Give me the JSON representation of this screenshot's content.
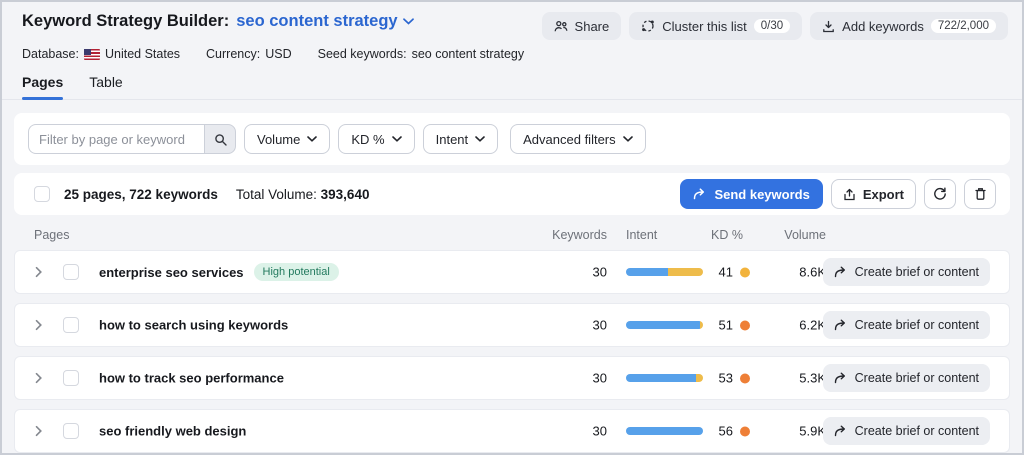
{
  "header": {
    "title": "Keyword Strategy Builder:",
    "list_name": "seo content strategy",
    "share_label": "Share",
    "cluster_label": "Cluster this list",
    "cluster_badge": "0/30",
    "add_keywords_label": "Add keywords",
    "add_keywords_badge": "722/2,000"
  },
  "meta": {
    "database_label": "Database:",
    "database_value": "United States",
    "currency_label": "Currency:",
    "currency_value": "USD",
    "seed_label": "Seed keywords:",
    "seed_value": "seo content strategy"
  },
  "tabs": {
    "pages": "Pages",
    "table": "Table"
  },
  "filters": {
    "search_placeholder": "Filter by page or keyword",
    "volume": "Volume",
    "kd": "KD %",
    "intent": "Intent",
    "advanced": "Advanced filters"
  },
  "summary": {
    "selection": "25 pages, 722 keywords",
    "total_volume_label": "Total Volume:",
    "total_volume_value": "393,640",
    "send_label": "Send keywords",
    "export_label": "Export"
  },
  "table": {
    "columns": {
      "pages": "Pages",
      "keywords": "Keywords",
      "intent": "Intent",
      "kd": "KD %",
      "volume": "Volume"
    },
    "action_label": "Create brief or content",
    "rows": [
      {
        "page": "enterprise seo services",
        "badge": "High potential",
        "keywords": "30",
        "intent_segments": [
          {
            "color": "#57a1ea",
            "pct": 55
          },
          {
            "color": "#eebc4b",
            "pct": 45
          }
        ],
        "kd": "41",
        "kd_color": "#f2b33c",
        "volume": "8.6K"
      },
      {
        "page": "how to search using keywords",
        "keywords": "30",
        "intent_segments": [
          {
            "color": "#57a1ea",
            "pct": 96
          },
          {
            "color": "#eebc4b",
            "pct": 4
          }
        ],
        "kd": "51",
        "kd_color": "#ee7f37",
        "volume": "6.2K"
      },
      {
        "page": "how to track seo performance",
        "keywords": "30",
        "intent_segments": [
          {
            "color": "#57a1ea",
            "pct": 91
          },
          {
            "color": "#eebc4b",
            "pct": 9
          }
        ],
        "kd": "53",
        "kd_color": "#ee7f37",
        "volume": "5.3K"
      },
      {
        "page": "seo friendly web design",
        "keywords": "30",
        "intent_segments": [
          {
            "color": "#57a1ea",
            "pct": 100
          }
        ],
        "kd": "56",
        "kd_color": "#ee7f37",
        "volume": "5.9K"
      }
    ]
  },
  "colors": {
    "accent_blue": "#3372e0",
    "link_blue": "#2b66d0",
    "intent_informational": "#57a1ea",
    "intent_commercial": "#eebc4b",
    "kd_possible": "#f2b33c",
    "kd_difficult": "#ee7f37",
    "badge_green_bg": "#dcf2e8",
    "badge_green_text": "#237a5e"
  }
}
